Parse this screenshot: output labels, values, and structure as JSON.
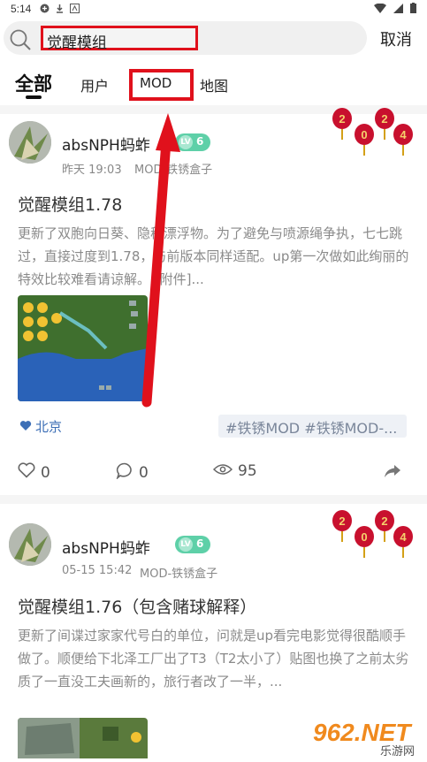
{
  "status_bar": {
    "time": "5:14"
  },
  "search": {
    "value": "觉醒模组",
    "cancel_label": "取消"
  },
  "tabs": [
    {
      "label": "全部"
    },
    {
      "label": "用户"
    },
    {
      "label": "MOD"
    },
    {
      "label": "地图"
    }
  ],
  "posts": [
    {
      "username": "absNPH蚂蚱",
      "level_prefix": "LV",
      "level": "6",
      "time": "昨天 19:03",
      "source": "MOD-铁锈盒子",
      "title": "觉醒模组1.78",
      "body": "更新了双胞向日葵、隐秘漂浮物。为了避免与喷源绳争执，七七跳过，直接过度到1.78，与前版本同样适配。up第一次做如此绚丽的特效比较难看请谅解。 [附件]...",
      "location": "北京",
      "tags": "#铁锈MOD  #铁锈MOD-...",
      "likes": "0",
      "comments": "0",
      "views": "95"
    },
    {
      "username": "absNPH蚂蚱",
      "level_prefix": "LV",
      "level": "6",
      "time": "05-15 15:42",
      "source": "MOD-铁锈盒子",
      "title": "觉醒模组1.76（包含赌球解释）",
      "body": "更新了间谍过家家代号白的单位，问就是up看完电影觉得很酷顺手做了。顺便给下北泽工厂出了T3（T2太小了）贴图也换了之前太劣质了一直没工夫画新的，旅行者改了一半，..."
    }
  ],
  "lantern_text": [
    "2",
    "0",
    "2",
    "4"
  ],
  "watermark": {
    "brand": "962.NET",
    "sub": "乐游网"
  },
  "colors": {
    "annotation_red": "#e0111c",
    "level_badge": "#5ed0a8",
    "location_blue": "#3d6fb6"
  }
}
